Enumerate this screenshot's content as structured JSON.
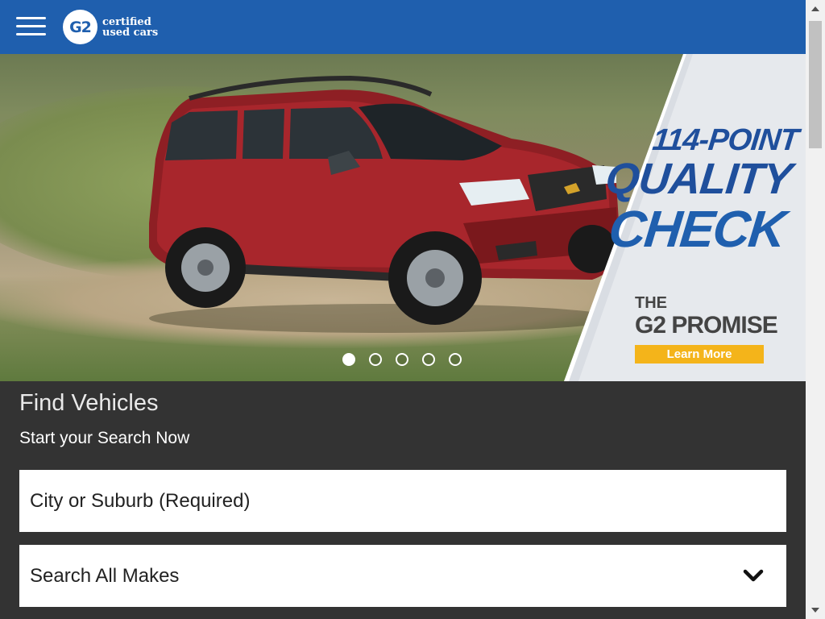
{
  "header": {
    "logo_mark": "G2",
    "logo_line1": "certified",
    "logo_line2": "used cars"
  },
  "hero": {
    "promo_line1": "114-POINT",
    "promo_line2": "QUALITY",
    "promo_line3": "CHECK",
    "promo_the": "THE",
    "promo_g2": "G2 PROMISE",
    "learn_more": "Learn More",
    "slide_count": 5,
    "active_slide": 1
  },
  "search": {
    "title": "Find Vehicles",
    "subtitle": "Start your Search Now",
    "city_placeholder": "City or Suburb (Required)",
    "makes_selected": "Search All Makes"
  },
  "colors": {
    "header_bg": "#1f5fae",
    "search_bg": "#333333",
    "learn_more_bg": "#f4b41a",
    "promo_text": "#1f4f9c"
  },
  "icons": {
    "menu": "hamburger-icon",
    "dropdown": "chevron-down-icon"
  }
}
